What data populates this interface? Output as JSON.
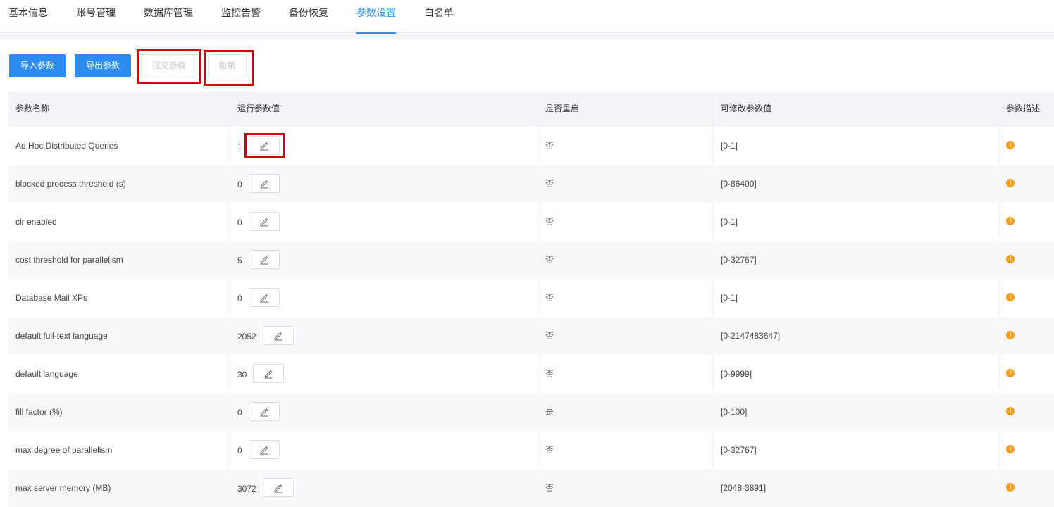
{
  "tabs": [
    {
      "label": "基本信息"
    },
    {
      "label": "账号管理"
    },
    {
      "label": "数据库管理"
    },
    {
      "label": "监控告警"
    },
    {
      "label": "备份恢复"
    },
    {
      "label": "参数设置",
      "active": true
    },
    {
      "label": "白名单"
    }
  ],
  "toolbar": {
    "import_label": "导入参数",
    "export_label": "导出参数",
    "submit_label": "提交参数",
    "cancel_label": "撤销"
  },
  "table": {
    "headers": {
      "name": "参数名称",
      "running_value": "运行参数值",
      "restart": "是否重启",
      "range": "可修改参数值",
      "description": "参数描述"
    },
    "rows": [
      {
        "name": "Ad Hoc Distributed Queries",
        "value": "1",
        "restart": "否",
        "range": "[0-1]"
      },
      {
        "name": "blocked process threshold (s)",
        "value": "0",
        "restart": "否",
        "range": "[0-86400]"
      },
      {
        "name": "clr enabled",
        "value": "0",
        "restart": "否",
        "range": "[0-1]"
      },
      {
        "name": "cost threshold for parallelism",
        "value": "5",
        "restart": "否",
        "range": "[0-32767]"
      },
      {
        "name": "Database Mail XPs",
        "value": "0",
        "restart": "否",
        "range": "[0-1]"
      },
      {
        "name": "default full-text language",
        "value": "2052",
        "restart": "否",
        "range": "[0-2147483647]"
      },
      {
        "name": "default language",
        "value": "30",
        "restart": "否",
        "range": "[0-9999]"
      },
      {
        "name": "fill factor (%)",
        "value": "0",
        "restart": "是",
        "range": "[0-100]"
      },
      {
        "name": "max degree of parallelism",
        "value": "0",
        "restart": "否",
        "range": "[0-32767]"
      },
      {
        "name": "max server memory (MB)",
        "value": "3072",
        "restart": "否",
        "range": "[2048-3891]"
      }
    ]
  },
  "icons": {
    "edit": "pencil-icon",
    "description": "info-icon"
  },
  "colors": {
    "primary": "#2d8cf0",
    "highlight": "#d90000",
    "info": "#f0a020"
  }
}
